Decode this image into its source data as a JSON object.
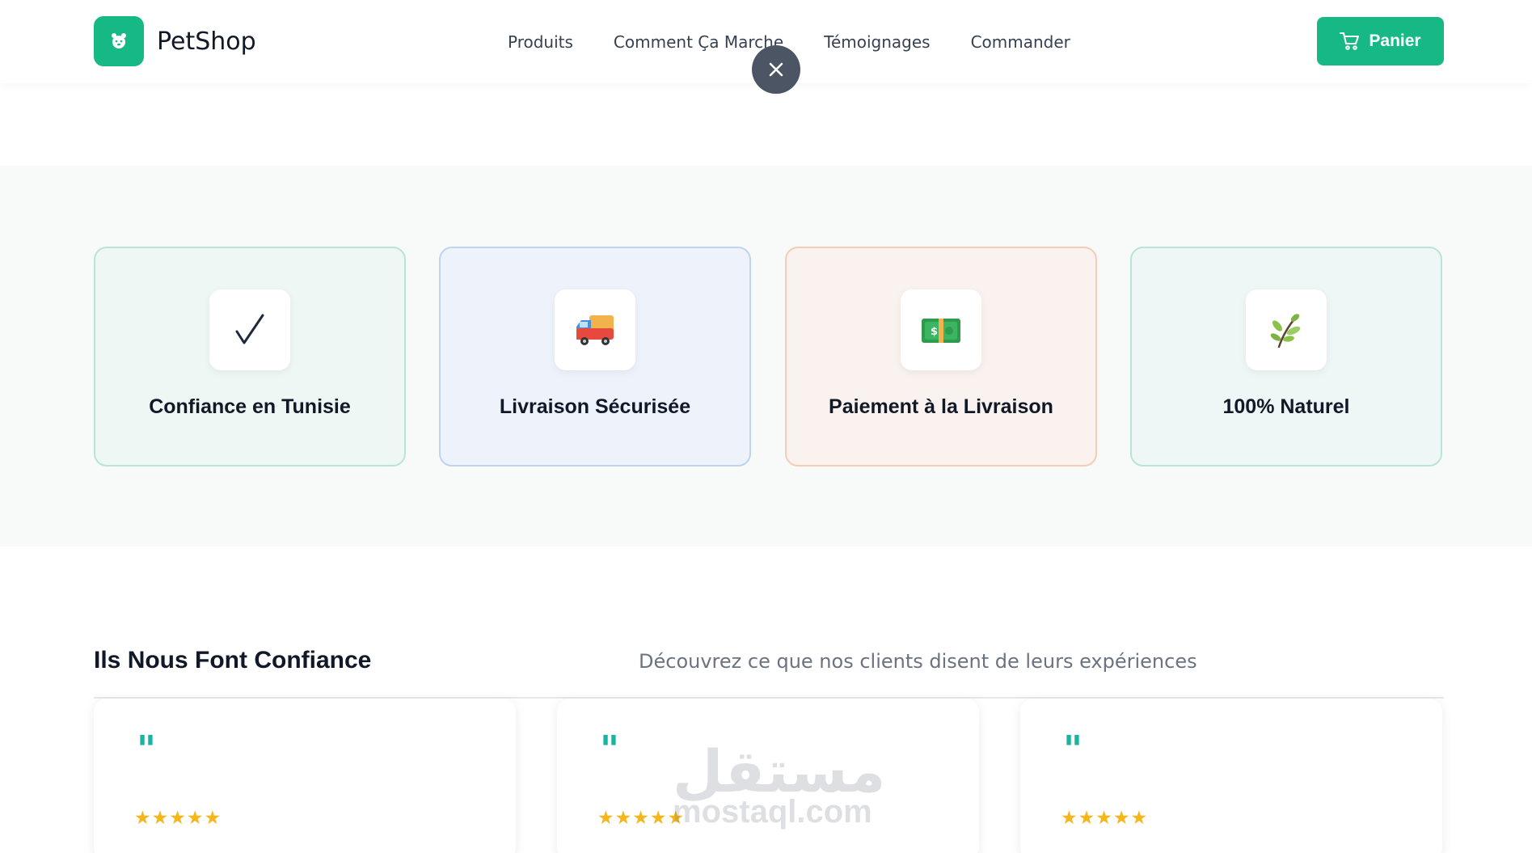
{
  "header": {
    "logo_text": "PetShop",
    "nav": [
      "Produits",
      "Comment Ça Marche",
      "Témoignages",
      "Commander"
    ],
    "cart_label": "Panier"
  },
  "features": [
    {
      "title": "Confiance en Tunisie",
      "icon": "checkmark-icon"
    },
    {
      "title": "Livraison Sécurisée",
      "icon": "delivery-truck-icon"
    },
    {
      "title": "Paiement à la Livraison",
      "icon": "banknote-icon"
    },
    {
      "title": "100% Naturel",
      "icon": "herb-icon"
    }
  ],
  "testimonials": {
    "title": "Ils Nous Font Confiance",
    "subtitle": "Découvrez ce que nos clients disent de leurs expériences",
    "cards": [
      {
        "quote_mark": "\"",
        "rating": "★★★★★"
      },
      {
        "quote_mark": "\"",
        "rating": "★★★★★"
      },
      {
        "quote_mark": "\"",
        "rating": "★★★★★"
      }
    ]
  },
  "watermark": {
    "arabic": "مستقل",
    "latin": "mostaql.com"
  },
  "colors": {
    "brand": "#16b985",
    "quote": "#16b4a1",
    "star": "#f6b519",
    "close_button": "#4b5563"
  }
}
